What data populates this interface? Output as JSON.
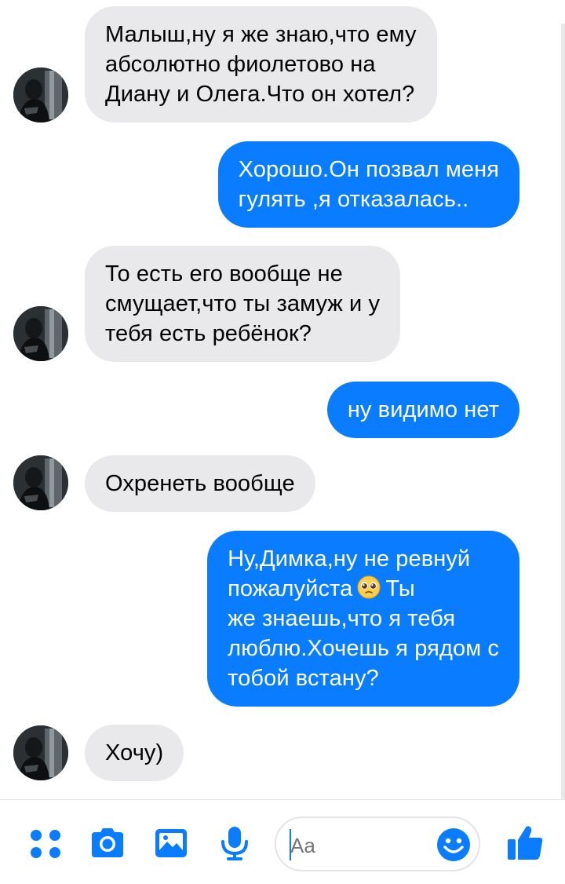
{
  "colors": {
    "incoming_bubble": "#e9e9eb",
    "outgoing_bubble": "#0a7cff",
    "accent": "#0a7cff",
    "background": "#ffffff"
  },
  "messages": [
    {
      "direction": "incoming",
      "lines": [
        "Малыш,ну я же знаю,что ему",
        "абсолютно фиолетово на",
        "Диану и Олега.Что он хотел?"
      ]
    },
    {
      "direction": "outgoing",
      "lines": [
        "Хорошо.Он позвал меня",
        "гулять ,я отказалась.."
      ]
    },
    {
      "direction": "incoming",
      "lines": [
        "То есть его вообще не",
        "смущает,что ты замуж и у",
        "тебя есть ребёнок?"
      ]
    },
    {
      "direction": "outgoing",
      "lines": [
        "ну видимо нет"
      ]
    },
    {
      "direction": "incoming",
      "lines": [
        "Охренеть вообще"
      ]
    },
    {
      "direction": "outgoing",
      "lines": [
        "Ну,Димка,ну не ревнуй",
        "пожалуйста",
        "Ты",
        "же знаешь,что я тебя",
        "люблю.Хочешь я рядом с",
        "тобой встану?"
      ],
      "emoji": "pleading-face-icon"
    },
    {
      "direction": "incoming",
      "lines": [
        "Хочу)"
      ]
    }
  ],
  "composer": {
    "placeholder": "Aa",
    "icons": [
      "more-apps-icon",
      "camera-icon",
      "gallery-icon",
      "microphone-icon",
      "emoji-icon",
      "thumbs-up-icon"
    ]
  }
}
